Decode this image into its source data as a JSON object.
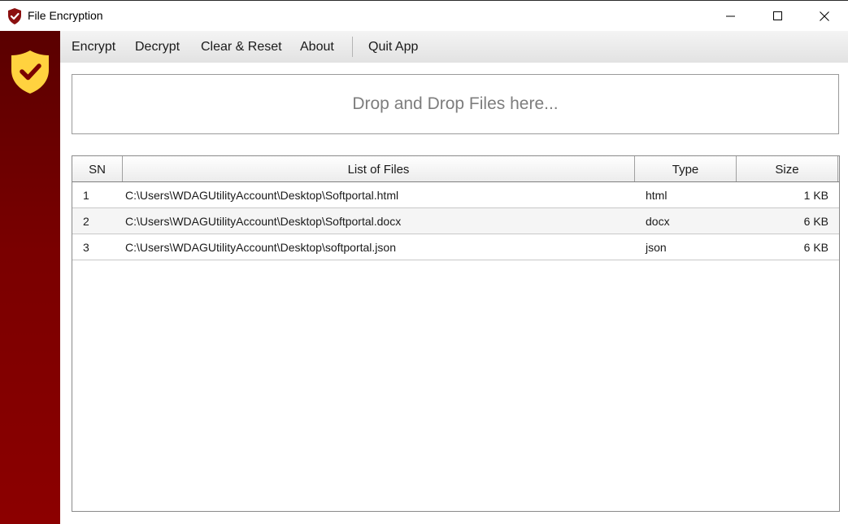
{
  "window": {
    "title": "File Encryption",
    "controls": [
      "minimize-icon",
      "maximize-icon",
      "close-icon"
    ],
    "accent_color": "#8b0000",
    "logo_color": "#ffd23f"
  },
  "menu": {
    "encrypt": "Encrypt",
    "decrypt": "Decrypt",
    "clear_reset": "Clear & Reset",
    "about": "About",
    "quit": "Quit App"
  },
  "dropzone": {
    "text": "Drop and Drop Files here..."
  },
  "table": {
    "columns": {
      "sn": "SN",
      "file": "List of Files",
      "type": "Type",
      "size": "Size"
    },
    "rows": [
      {
        "sn": "1",
        "file": "C:\\Users\\WDAGUtilityAccount\\Desktop\\Softportal.html",
        "type": "html",
        "size": "1 KB"
      },
      {
        "sn": "2",
        "file": "C:\\Users\\WDAGUtilityAccount\\Desktop\\Softportal.docx",
        "type": "docx",
        "size": "6 KB"
      },
      {
        "sn": "3",
        "file": "C:\\Users\\WDAGUtilityAccount\\Desktop\\softportal.json",
        "type": "json",
        "size": "6 KB"
      }
    ]
  }
}
